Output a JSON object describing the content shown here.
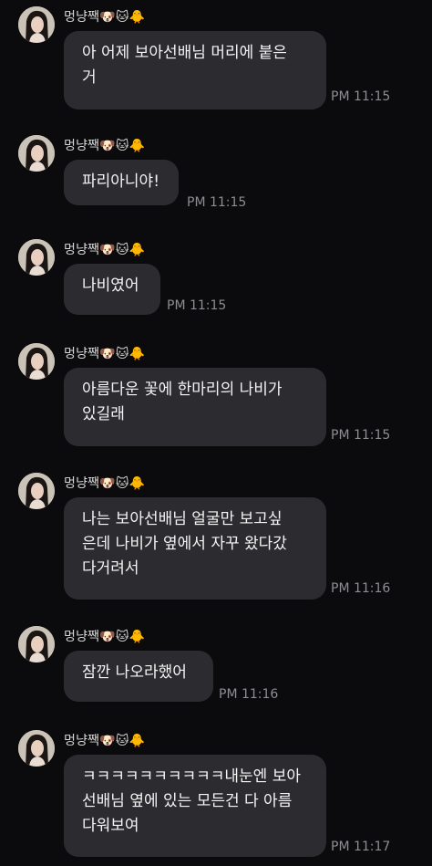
{
  "chat": {
    "messages": [
      {
        "sender": "멍냥짹🐶🐱🐥",
        "text": "아 어제 보아선배님 머리에 붙은\n거",
        "time": "PM 11:15"
      },
      {
        "sender": "멍냥짹🐶🐱🐥",
        "text": "파리아니야!",
        "time": "PM 11:15"
      },
      {
        "sender": "멍냥짹🐶🐱🐥",
        "text": "나비였어",
        "time": "PM 11:15"
      },
      {
        "sender": "멍냥짹🐶🐱🐥",
        "text": "아름다운 꽃에 한마리의 나비가\n있길래",
        "time": "PM 11:15"
      },
      {
        "sender": "멍냥짹🐶🐱🐥",
        "text": "나는 보아선배님 얼굴만 보고싶\n은데 나비가 옆에서 자꾸 왔다갔\n다거려서",
        "time": "PM 11:16"
      },
      {
        "sender": "멍냥짹🐶🐱🐥",
        "text": "잠깐 나오라했어",
        "time": "PM 11:16"
      },
      {
        "sender": "멍냥짹🐶🐱🐥",
        "text": "ㅋㅋㅋㅋㅋㅋㅋㅋㅋㅋ내눈엔 보아\n선배님 옆에 있는 모든건 다 아름\n다워보여",
        "time": "PM 11:17"
      }
    ]
  }
}
